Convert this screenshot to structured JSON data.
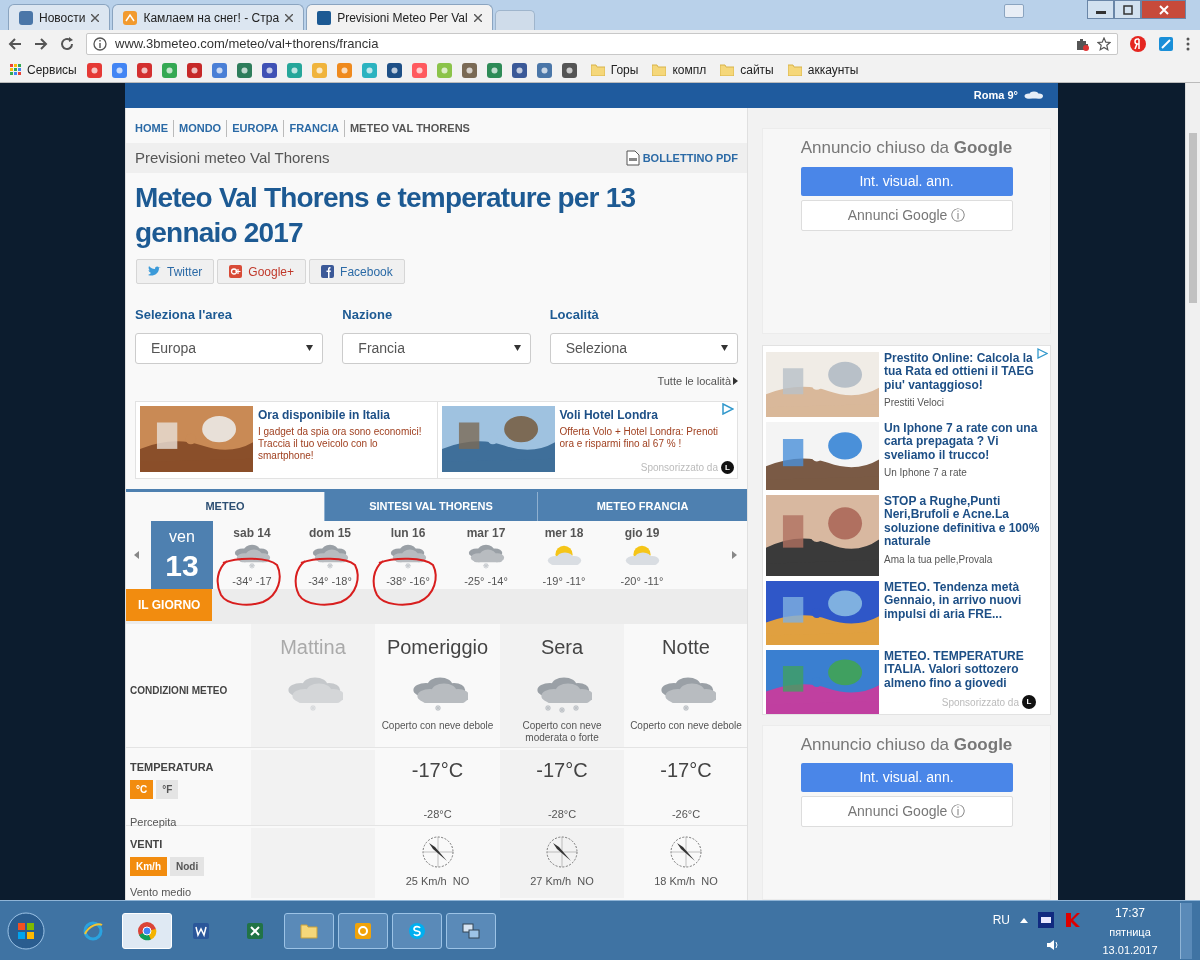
{
  "browser": {
    "tabs": [
      {
        "title": "Новости",
        "selected": false
      },
      {
        "title": "Камлаем на снег! - Стра",
        "selected": false
      },
      {
        "title": "Previsioni Meteo Per Val",
        "selected": true
      }
    ],
    "address": "www.3bmeteo.com/meteo/val+thorens/francia",
    "bookmarks": [
      {
        "kind": "apps",
        "label": "Сервисы"
      },
      {
        "kind": "site",
        "color": "#e53935"
      },
      {
        "kind": "site",
        "color": "#4285f4"
      },
      {
        "kind": "site",
        "color": "#d32f2f"
      },
      {
        "kind": "site",
        "color": "#34a853"
      },
      {
        "kind": "site",
        "color": "#c62828"
      },
      {
        "kind": "site",
        "color": "#4a7fd6"
      },
      {
        "kind": "site",
        "color": "#2e7d5b"
      },
      {
        "kind": "site",
        "color": "#3f51b5"
      },
      {
        "kind": "site",
        "color": "#26a69a"
      },
      {
        "kind": "site",
        "color": "#f0b43c"
      },
      {
        "kind": "site",
        "color": "#ef8a1e"
      },
      {
        "kind": "site",
        "color": "#2bb3c0"
      },
      {
        "kind": "site",
        "color": "#1d4f86"
      },
      {
        "kind": "site",
        "color": "#ff5a5f"
      },
      {
        "kind": "site",
        "color": "#8bc34a"
      },
      {
        "kind": "site",
        "color": "#7a6a55"
      },
      {
        "kind": "site",
        "color": "#2e8b57"
      },
      {
        "kind": "site",
        "color": "#3b5998"
      },
      {
        "kind": "site",
        "color": "#4a76a8"
      },
      {
        "kind": "site",
        "color": "#555555"
      },
      {
        "kind": "folder",
        "label": "Горы"
      },
      {
        "kind": "folder",
        "label": "компл"
      },
      {
        "kind": "folder",
        "label": "сайты"
      },
      {
        "kind": "folder",
        "label": "аккаунты"
      }
    ]
  },
  "header": {
    "city": "Roma 9°"
  },
  "breadcrumbs": [
    {
      "label": "HOME",
      "link": true
    },
    {
      "label": "MONDO",
      "link": true
    },
    {
      "label": "EUROPA",
      "link": true
    },
    {
      "label": "FRANCIA",
      "link": true
    },
    {
      "label": "METEO VAL THORENS",
      "link": false
    }
  ],
  "subtitle": "Previsioni meteo Val Thorens",
  "pdf_link": "BOLLETTINO PDF",
  "title": "Meteo Val Thorens e temperature per 13 gennaio 2017",
  "share": [
    {
      "kind": "twitter",
      "label": "Twitter"
    },
    {
      "kind": "google",
      "label": "Google+"
    },
    {
      "kind": "facebook",
      "label": "Facebook"
    }
  ],
  "selects": [
    {
      "label": "Seleziona l'area",
      "value": "Europa"
    },
    {
      "label": "Nazione",
      "value": "Francia"
    },
    {
      "label": "Località",
      "value": "Seleziona"
    }
  ],
  "all_places_link": "Tutte le località",
  "ads": [
    {
      "title": "Ora disponibile in Italia",
      "text": "I gadget da spia ora sono economici! Traccia il tuo veicolo con lo smartphone!"
    },
    {
      "title": "Voli Hotel Londra",
      "text": "Offerta Volo + Hotel Londra: Prenoti ora e risparmi fino al 67 % !"
    }
  ],
  "ads_sponsor": {
    "text": "Sponsorizzato da",
    "logo": "L"
  },
  "tabs": [
    {
      "label": "METEO",
      "selected": true
    },
    {
      "label": "SINTESI VAL THORENS",
      "selected": false
    },
    {
      "label": "METEO FRANCIA",
      "selected": false
    }
  ],
  "days": [
    {
      "weekday": "ven",
      "date": "13",
      "selected": true,
      "circled": false
    },
    {
      "weekday": "sab",
      "date": "14",
      "selected": false,
      "kind": "snow",
      "temps": "-34° -17",
      "circled": true
    },
    {
      "weekday": "dom",
      "date": "15",
      "selected": false,
      "kind": "snow",
      "temps": "-34° -18°",
      "circled": true
    },
    {
      "weekday": "lun",
      "date": "16",
      "selected": false,
      "kind": "snow",
      "temps": "-38° -16°",
      "circled": true
    },
    {
      "weekday": "mar",
      "date": "17",
      "selected": false,
      "kind": "snow",
      "temps": "-25° -14°",
      "circled": false
    },
    {
      "weekday": "mer",
      "date": "18",
      "selected": false,
      "kind": "sun_cloud",
      "temps": "-19° -11°",
      "circled": false
    },
    {
      "weekday": "gio",
      "date": "19",
      "selected": false,
      "kind": "sun_cloud",
      "temps": "-20° -11°",
      "circled": false
    }
  ],
  "day_section": "IL GIORNO",
  "table": {
    "conditions_label": "CONDIZIONI METEO",
    "temperature_label": "TEMPERATURA",
    "feels_label": "Percepita",
    "wind_label": "VENTI",
    "wind_avg_label": "Vento medio",
    "temp_units": [
      {
        "label": "°C",
        "selected": true
      },
      {
        "label": "°F",
        "selected": false
      }
    ],
    "wind_units": [
      {
        "label": "Km/h",
        "selected": true
      },
      {
        "label": "Nodi",
        "selected": false
      }
    ],
    "periods": [
      {
        "name": "Mattina",
        "past": true,
        "kind": "snow_light"
      },
      {
        "name": "Pomeriggio",
        "past": false,
        "kind": "snow_light",
        "description": "Coperto con neve debole",
        "temperature": "-17°C",
        "feels": "-28°C",
        "wind": "25 Km/h  NO"
      },
      {
        "name": "Sera",
        "past": false,
        "kind": "snow_heavy",
        "description": "Coperto con neve moderata o forte",
        "temperature": "-17°C",
        "feels": "-28°C",
        "wind": "27 Km/h  NO"
      },
      {
        "name": "Notte",
        "past": false,
        "kind": "snow_light",
        "description": "Coperto con neve debole",
        "temperature": "-17°C",
        "feels": "-26°C",
        "wind": "18 Km/h  NO"
      }
    ]
  },
  "google_boxes": [
    {
      "closed": "Annuncio chiuso da **Google**",
      "button": "Int. visual. ann.",
      "link": "Annunci Google ⓘ"
    },
    {
      "closed": "Annuncio chiuso da **Google**",
      "button": "Int. visual. ann.",
      "link": "Annunci Google ⓘ"
    }
  ],
  "native_ads": [
    {
      "title": "Prestito Online: Calcola la tua Rata ed ottieni il TAEG piu' vantaggioso!",
      "source": "Prestiti Veloci"
    },
    {
      "title": "Un Iphone 7 a rate con una carta prepagata ? Vi sveliamo il trucco!",
      "source": "Un Iphone 7 a rate"
    },
    {
      "title": "STOP a Rughe,Punti Neri,Brufoli e Acne.La soluzione definitiva e 100% naturale",
      "source": "Ama la tua pelle,Provala"
    },
    {
      "title": "METEO. Tendenza metà Gennaio, in arrivo nuovi impulsi di aria FRE..."
    },
    {
      "title": "METEO. TEMPERATURE ITALIA. Valori sottozero almeno fino a giovedi"
    }
  ],
  "native_sponsor": {
    "text": "Sponsorizzato da",
    "logo": "L"
  },
  "taskbar": {
    "apps": [
      {
        "kind": "ie",
        "active": false
      },
      {
        "kind": "chrome",
        "active": true
      },
      {
        "kind": "word",
        "active": false
      },
      {
        "kind": "excel",
        "active": false
      },
      {
        "kind": "folder",
        "active": false
      },
      {
        "kind": "outlook",
        "active": false
      },
      {
        "kind": "skype",
        "active": false
      },
      {
        "kind": "network",
        "active": false
      }
    ],
    "language": "RU",
    "time": "17:37",
    "weekday": "пятница",
    "date": "13.01.2017"
  }
}
